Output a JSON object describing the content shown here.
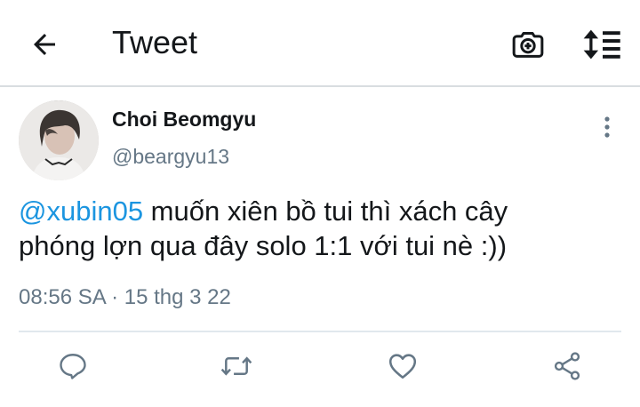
{
  "header": {
    "title": "Tweet",
    "back_icon": "arrow-left-icon",
    "camera_icon": "camera-add-icon",
    "sort_icon": "sort-list-icon"
  },
  "tweet": {
    "author_name": "Choi Beomgyu",
    "author_handle": "@beargyu13",
    "mention": "@xubin05",
    "body_line1": " muốn xiên bồ tui thì xách cây",
    "body_line2": "phóng lợn qua đây solo 1:1 với tui nè :))",
    "timestamp": "08:56 SA · 15 thg 3 22",
    "more_icon": "more-vertical-icon"
  },
  "actions": [
    {
      "name": "reply",
      "icon": "reply-icon"
    },
    {
      "name": "retweet",
      "icon": "retweet-icon"
    },
    {
      "name": "like",
      "icon": "heart-icon"
    },
    {
      "name": "share",
      "icon": "share-icon"
    }
  ],
  "colors": {
    "text": "#14171a",
    "secondary": "#657786",
    "link": "#1b95e0",
    "icon": "#657786",
    "divider": "#e1e8ed"
  }
}
